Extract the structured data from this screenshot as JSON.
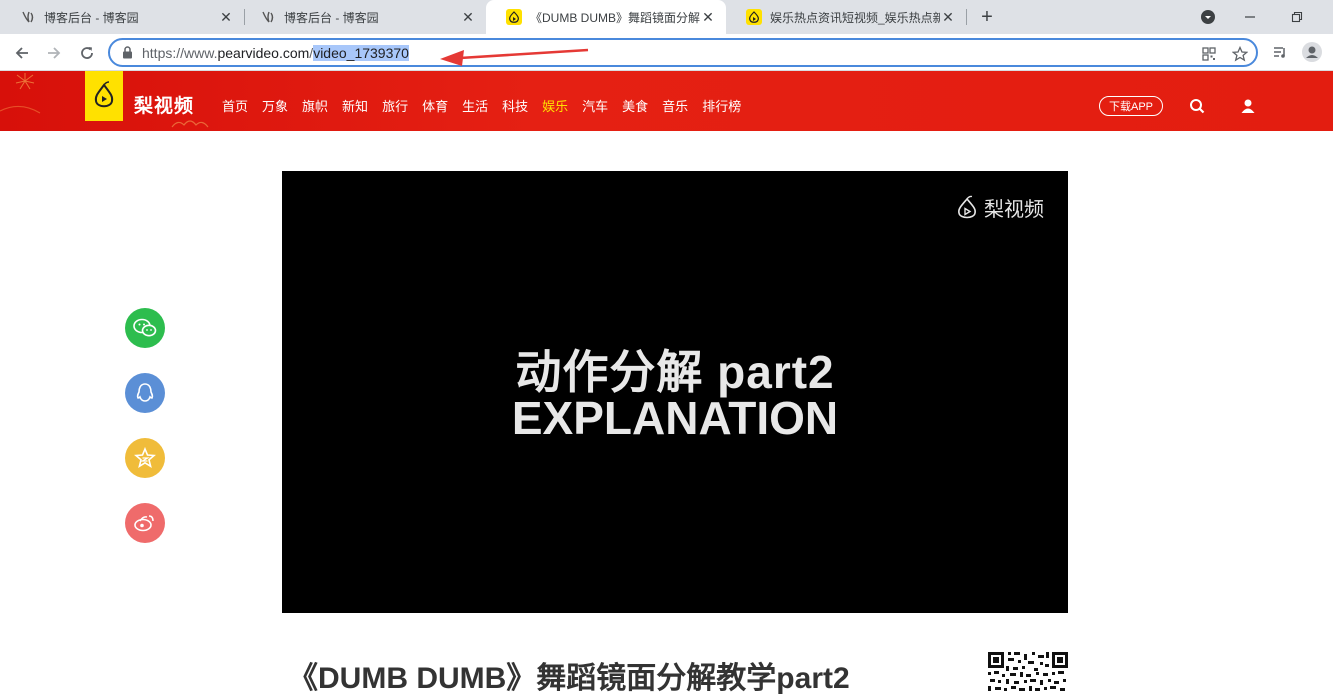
{
  "browser": {
    "tabs": [
      {
        "title": "博客后台 - 博客园",
        "close": "✕"
      },
      {
        "title": "博客后台 - 博客园",
        "close": "✕"
      },
      {
        "title": "《DUMB DUMB》舞蹈镜面分解",
        "close": "✕"
      },
      {
        "title": "娱乐热点资讯短视频_娱乐热点新",
        "close": "✕"
      }
    ],
    "new_tab": "+",
    "url_host_prefix": "https://www.",
    "url_host_domain": "pearvideo.com",
    "url_slash": "/",
    "url_path": "video_1739370"
  },
  "site": {
    "logo_text": "梨视频",
    "nav": [
      "首页",
      "万象",
      "旗帜",
      "新知",
      "旅行",
      "体育",
      "生活",
      "科技",
      "娱乐",
      "汽车",
      "美食",
      "音乐",
      "排行榜"
    ],
    "active_nav": "娱乐",
    "app_button": "下载APP"
  },
  "video": {
    "watermark": "梨视频",
    "line1": "动作分解  part2",
    "line2": "EXPLANATION",
    "title": "《DUMB DUMB》舞蹈镜面分解教学part2"
  },
  "share": {
    "wechat_color": "#2dbd4e",
    "qq_color": "#5b8fd6",
    "qzone_color": "#f0bc3a",
    "weibo_color": "#ef6b6b"
  },
  "colors": {
    "header_red": "#e31d10",
    "logo_yellow": "#ffe100",
    "annotation_red": "#e53935"
  }
}
